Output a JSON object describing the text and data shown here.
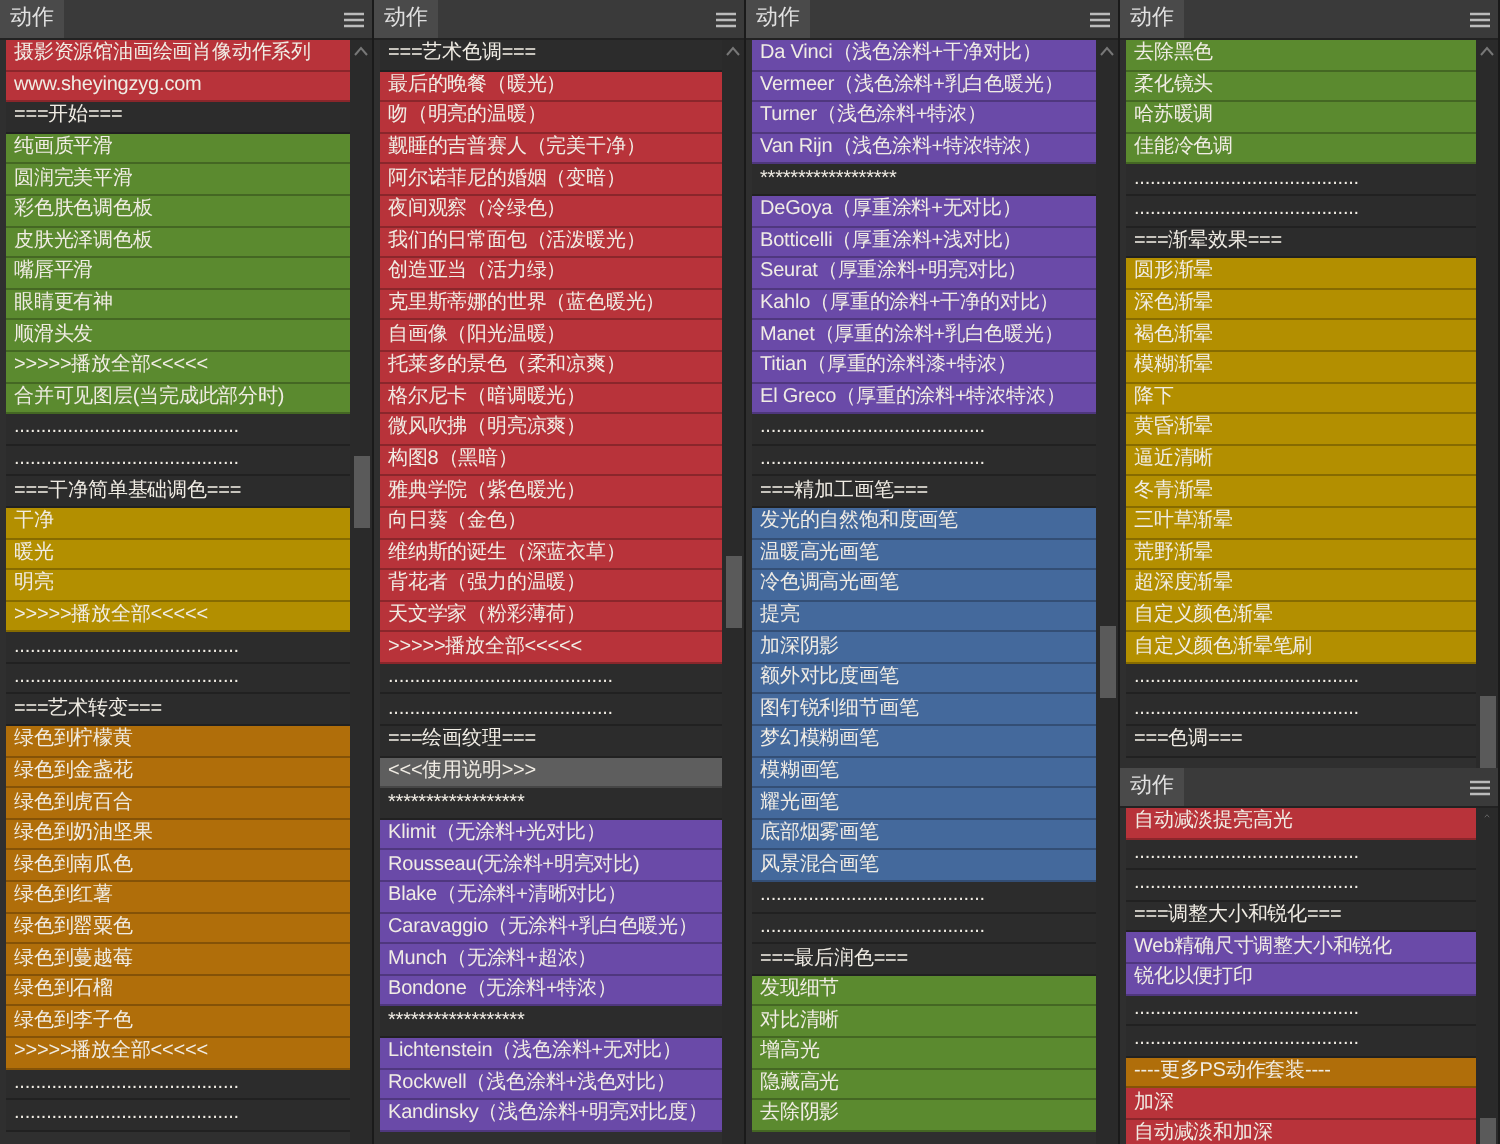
{
  "columns": [
    {
      "panels": [
        {
          "tab": "动作",
          "rows": [
            {
              "text": "摄影资源馆油画绘画肖像动作系列",
              "color": "#b8333a"
            },
            {
              "text": "www.sheyingzyg.com",
              "color": "#b8333a"
            },
            {
              "text": "===开始===",
              "color": "#2c2c2c"
            },
            {
              "text": "纯画质平滑",
              "color": "#5b8a2f"
            },
            {
              "text": "圆润完美平滑",
              "color": "#5b8a2f"
            },
            {
              "text": "彩色肤色调色板",
              "color": "#5b8a2f"
            },
            {
              "text": "皮肤光泽调色板",
              "color": "#5b8a2f"
            },
            {
              "text": "嘴唇平滑",
              "color": "#5b8a2f"
            },
            {
              "text": "眼睛更有神",
              "color": "#5b8a2f"
            },
            {
              "text": "顺滑头发",
              "color": "#5b8a2f"
            },
            {
              "text": ">>>>>播放全部<<<<<",
              "color": "#5b8a2f"
            },
            {
              "text": "合并可见图层(当完成此部分时)",
              "color": "#5b8a2f"
            },
            {
              "text": "..........................................",
              "color": "#2c2c2c"
            },
            {
              "text": "..........................................",
              "color": "#2c2c2c"
            },
            {
              "text": "===干净简单基础调色===",
              "color": "#2c2c2c"
            },
            {
              "text": "干净",
              "color": "#b38f00"
            },
            {
              "text": "暖光",
              "color": "#b38f00"
            },
            {
              "text": "明亮",
              "color": "#b38f00"
            },
            {
              "text": ">>>>>播放全部<<<<<",
              "color": "#b38f00"
            },
            {
              "text": "..........................................",
              "color": "#2c2c2c"
            },
            {
              "text": "..........................................",
              "color": "#2c2c2c"
            },
            {
              "text": "===艺术转变===",
              "color": "#2c2c2c"
            },
            {
              "text": "绿色到柠檬黄",
              "color": "#b06e0a"
            },
            {
              "text": "绿色到金盏花",
              "color": "#b06e0a"
            },
            {
              "text": "绿色到虎百合",
              "color": "#b06e0a"
            },
            {
              "text": "绿色到奶油坚果",
              "color": "#b06e0a"
            },
            {
              "text": "绿色到南瓜色",
              "color": "#b06e0a"
            },
            {
              "text": "绿色到红薯",
              "color": "#b06e0a"
            },
            {
              "text": "绿色到罂粟色",
              "color": "#b06e0a"
            },
            {
              "text": "绿色到蔓越莓",
              "color": "#b06e0a"
            },
            {
              "text": "绿色到石榴",
              "color": "#b06e0a"
            },
            {
              "text": "绿色到李子色",
              "color": "#b06e0a"
            },
            {
              "text": ">>>>>播放全部<<<<<",
              "color": "#b06e0a"
            },
            {
              "text": "..........................................",
              "color": "#2c2c2c"
            },
            {
              "text": "..........................................",
              "color": "#2c2c2c"
            }
          ]
        }
      ]
    },
    {
      "panels": [
        {
          "tab": "动作",
          "rows": [
            {
              "text": "===艺术色调===",
              "color": "#2c2c2c"
            },
            {
              "text": "最后的晚餐（暖光）",
              "color": "#b8333a"
            },
            {
              "text": "吻（明亮的温暖）",
              "color": "#b8333a"
            },
            {
              "text": "觐睡的吉普赛人（完美干净）",
              "color": "#b8333a"
            },
            {
              "text": "阿尔诺菲尼的婚姻（变暗）",
              "color": "#b8333a"
            },
            {
              "text": "夜间观察（冷绿色）",
              "color": "#b8333a"
            },
            {
              "text": "我们的日常面包（活泼暖光）",
              "color": "#b8333a"
            },
            {
              "text": "创造亚当（活力绿）",
              "color": "#b8333a"
            },
            {
              "text": "克里斯蒂娜的世界（蓝色暖光）",
              "color": "#b8333a"
            },
            {
              "text": "自画像（阳光温暖）",
              "color": "#b8333a"
            },
            {
              "text": "托莱多的景色（柔和凉爽）",
              "color": "#b8333a"
            },
            {
              "text": "格尔尼卡（暗调暖光）",
              "color": "#b8333a"
            },
            {
              "text": "微风吹拂（明亮凉爽）",
              "color": "#b8333a"
            },
            {
              "text": "构图8（黑暗）",
              "color": "#b8333a"
            },
            {
              "text": "雅典学院（紫色暖光）",
              "color": "#b8333a"
            },
            {
              "text": "向日葵（金色）",
              "color": "#b8333a"
            },
            {
              "text": "维纳斯的诞生（深蓝衣草）",
              "color": "#b8333a"
            },
            {
              "text": "背花者（强力的温暖）",
              "color": "#b8333a"
            },
            {
              "text": "天文学家（粉彩薄荷）",
              "color": "#b8333a"
            },
            {
              "text": ">>>>>播放全部<<<<<",
              "color": "#b8333a"
            },
            {
              "text": "..........................................",
              "color": "#2c2c2c"
            },
            {
              "text": "..........................................",
              "color": "#2c2c2c"
            },
            {
              "text": "===绘画纹理===",
              "color": "#2c2c2c"
            },
            {
              "text": "<<<使用说明>>>",
              "color": "#5e5e5e"
            },
            {
              "text": "******************",
              "color": "#2c2c2c"
            },
            {
              "text": "Klimit（无涂料+光对比）",
              "color": "#6a4aa8"
            },
            {
              "text": "Rousseau(无涂料+明亮对比)",
              "color": "#6a4aa8"
            },
            {
              "text": "Blake（无涂料+清晰对比）",
              "color": "#6a4aa8"
            },
            {
              "text": "Caravaggio（无涂料+乳白色暖光）",
              "color": "#6a4aa8"
            },
            {
              "text": "Munch（无涂料+超浓）",
              "color": "#6a4aa8"
            },
            {
              "text": "Bondone（无涂料+特浓）",
              "color": "#6a4aa8"
            },
            {
              "text": "******************",
              "color": "#2c2c2c"
            },
            {
              "text": "Lichtenstein（浅色涂料+无对比）",
              "color": "#6a4aa8"
            },
            {
              "text": "Rockwell（浅色涂料+浅色对比）",
              "color": "#6a4aa8"
            },
            {
              "text": "Kandinsky（浅色涂料+明亮对比度）",
              "color": "#6a4aa8"
            }
          ]
        }
      ]
    },
    {
      "panels": [
        {
          "tab": "动作",
          "rows": [
            {
              "text": "Da Vinci（浅色涂料+干净对比）",
              "color": "#6a4aa8"
            },
            {
              "text": "Vermeer（浅色涂料+乳白色暖光）",
              "color": "#6a4aa8"
            },
            {
              "text": "Turner（浅色涂料+特浓）",
              "color": "#6a4aa8"
            },
            {
              "text": "Van Rijn（浅色涂料+特浓特浓）",
              "color": "#6a4aa8"
            },
            {
              "text": "******************",
              "color": "#2c2c2c"
            },
            {
              "text": "DeGoya（厚重涂料+无对比）",
              "color": "#6a4aa8"
            },
            {
              "text": "Botticelli（厚重涂料+浅对比）",
              "color": "#6a4aa8"
            },
            {
              "text": "Seurat（厚重涂料+明亮对比）",
              "color": "#6a4aa8"
            },
            {
              "text": "Kahlo（厚重的涂料+干净的对比）",
              "color": "#6a4aa8"
            },
            {
              "text": "Manet（厚重的涂料+乳白色暖光）",
              "color": "#6a4aa8"
            },
            {
              "text": "Titian（厚重的涂料漆+特浓）",
              "color": "#6a4aa8"
            },
            {
              "text": "El Greco（厚重的涂料+特浓特浓）",
              "color": "#6a4aa8"
            },
            {
              "text": "..........................................",
              "color": "#2c2c2c"
            },
            {
              "text": "..........................................",
              "color": "#2c2c2c"
            },
            {
              "text": "===精加工画笔===",
              "color": "#2c2c2c"
            },
            {
              "text": "发光的自然饱和度画笔",
              "color": "#44699c"
            },
            {
              "text": "温暖高光画笔",
              "color": "#44699c"
            },
            {
              "text": "冷色调高光画笔",
              "color": "#44699c"
            },
            {
              "text": "提亮",
              "color": "#44699c"
            },
            {
              "text": "加深阴影",
              "color": "#44699c"
            },
            {
              "text": "额外对比度画笔",
              "color": "#44699c"
            },
            {
              "text": "图钉锐利细节画笔",
              "color": "#44699c"
            },
            {
              "text": "梦幻模糊画笔",
              "color": "#44699c"
            },
            {
              "text": "模糊画笔",
              "color": "#44699c"
            },
            {
              "text": "耀光画笔",
              "color": "#44699c"
            },
            {
              "text": "底部烟雾画笔",
              "color": "#44699c"
            },
            {
              "text": "风景混合画笔",
              "color": "#44699c"
            },
            {
              "text": "..........................................",
              "color": "#2c2c2c"
            },
            {
              "text": "..........................................",
              "color": "#2c2c2c"
            },
            {
              "text": "===最后润色===",
              "color": "#2c2c2c"
            },
            {
              "text": "发现细节",
              "color": "#5b8a2f"
            },
            {
              "text": "对比清晰",
              "color": "#5b8a2f"
            },
            {
              "text": "增高光",
              "color": "#5b8a2f"
            },
            {
              "text": "隐藏高光",
              "color": "#5b8a2f"
            },
            {
              "text": "去除阴影",
              "color": "#5b8a2f"
            }
          ]
        }
      ]
    },
    {
      "panels": [
        {
          "tab": "动作",
          "rows": [
            {
              "text": "去除黑色",
              "color": "#5b8a2f"
            },
            {
              "text": "柔化镜头",
              "color": "#5b8a2f"
            },
            {
              "text": "哈苏暖调",
              "color": "#5b8a2f"
            },
            {
              "text": "佳能冷色调",
              "color": "#5b8a2f"
            },
            {
              "text": "..........................................",
              "color": "#2c2c2c"
            },
            {
              "text": "..........................................",
              "color": "#2c2c2c"
            },
            {
              "text": "===渐晕效果===",
              "color": "#2c2c2c"
            },
            {
              "text": "圆形渐晕",
              "color": "#b38f00"
            },
            {
              "text": "深色渐晕",
              "color": "#b38f00"
            },
            {
              "text": "褐色渐晕",
              "color": "#b38f00"
            },
            {
              "text": "模糊渐晕",
              "color": "#b38f00"
            },
            {
              "text": "降下",
              "color": "#b38f00"
            },
            {
              "text": "黄昏渐晕",
              "color": "#b38f00"
            },
            {
              "text": "逼近清晰",
              "color": "#b38f00"
            },
            {
              "text": "冬青渐晕",
              "color": "#b38f00"
            },
            {
              "text": "三叶草渐晕",
              "color": "#b38f00"
            },
            {
              "text": "荒野渐晕",
              "color": "#b38f00"
            },
            {
              "text": "超深度渐晕",
              "color": "#b38f00"
            },
            {
              "text": "自定义颜色渐晕",
              "color": "#b38f00"
            },
            {
              "text": "自定义颜色渐晕笔刷",
              "color": "#b38f00"
            },
            {
              "text": "..........................................",
              "color": "#2c2c2c"
            },
            {
              "text": "..........................................",
              "color": "#2c2c2c"
            },
            {
              "text": "===色调===",
              "color": "#2c2c2c"
            }
          ]
        },
        {
          "tab": "动作",
          "rows": [
            {
              "text": "自动减淡提亮高光",
              "color": "#b8333a"
            },
            {
              "text": "..........................................",
              "color": "#2c2c2c"
            },
            {
              "text": "..........................................",
              "color": "#2c2c2c"
            },
            {
              "text": "===调整大小和锐化===",
              "color": "#2c2c2c"
            },
            {
              "text": "Web精确尺寸调整大小和锐化",
              "color": "#6a4aa8"
            },
            {
              "text": "锐化以便打印",
              "color": "#6a4aa8"
            },
            {
              "text": "..........................................",
              "color": "#2c2c2c"
            },
            {
              "text": "..........................................",
              "color": "#2c2c2c"
            },
            {
              "text": "----更多PS动作套装----",
              "color": "#b06e0a"
            },
            {
              "text": "加深",
              "color": "#b8333a"
            },
            {
              "text": "自动减淡和加深",
              "color": "#b8333a"
            }
          ]
        }
      ]
    }
  ]
}
